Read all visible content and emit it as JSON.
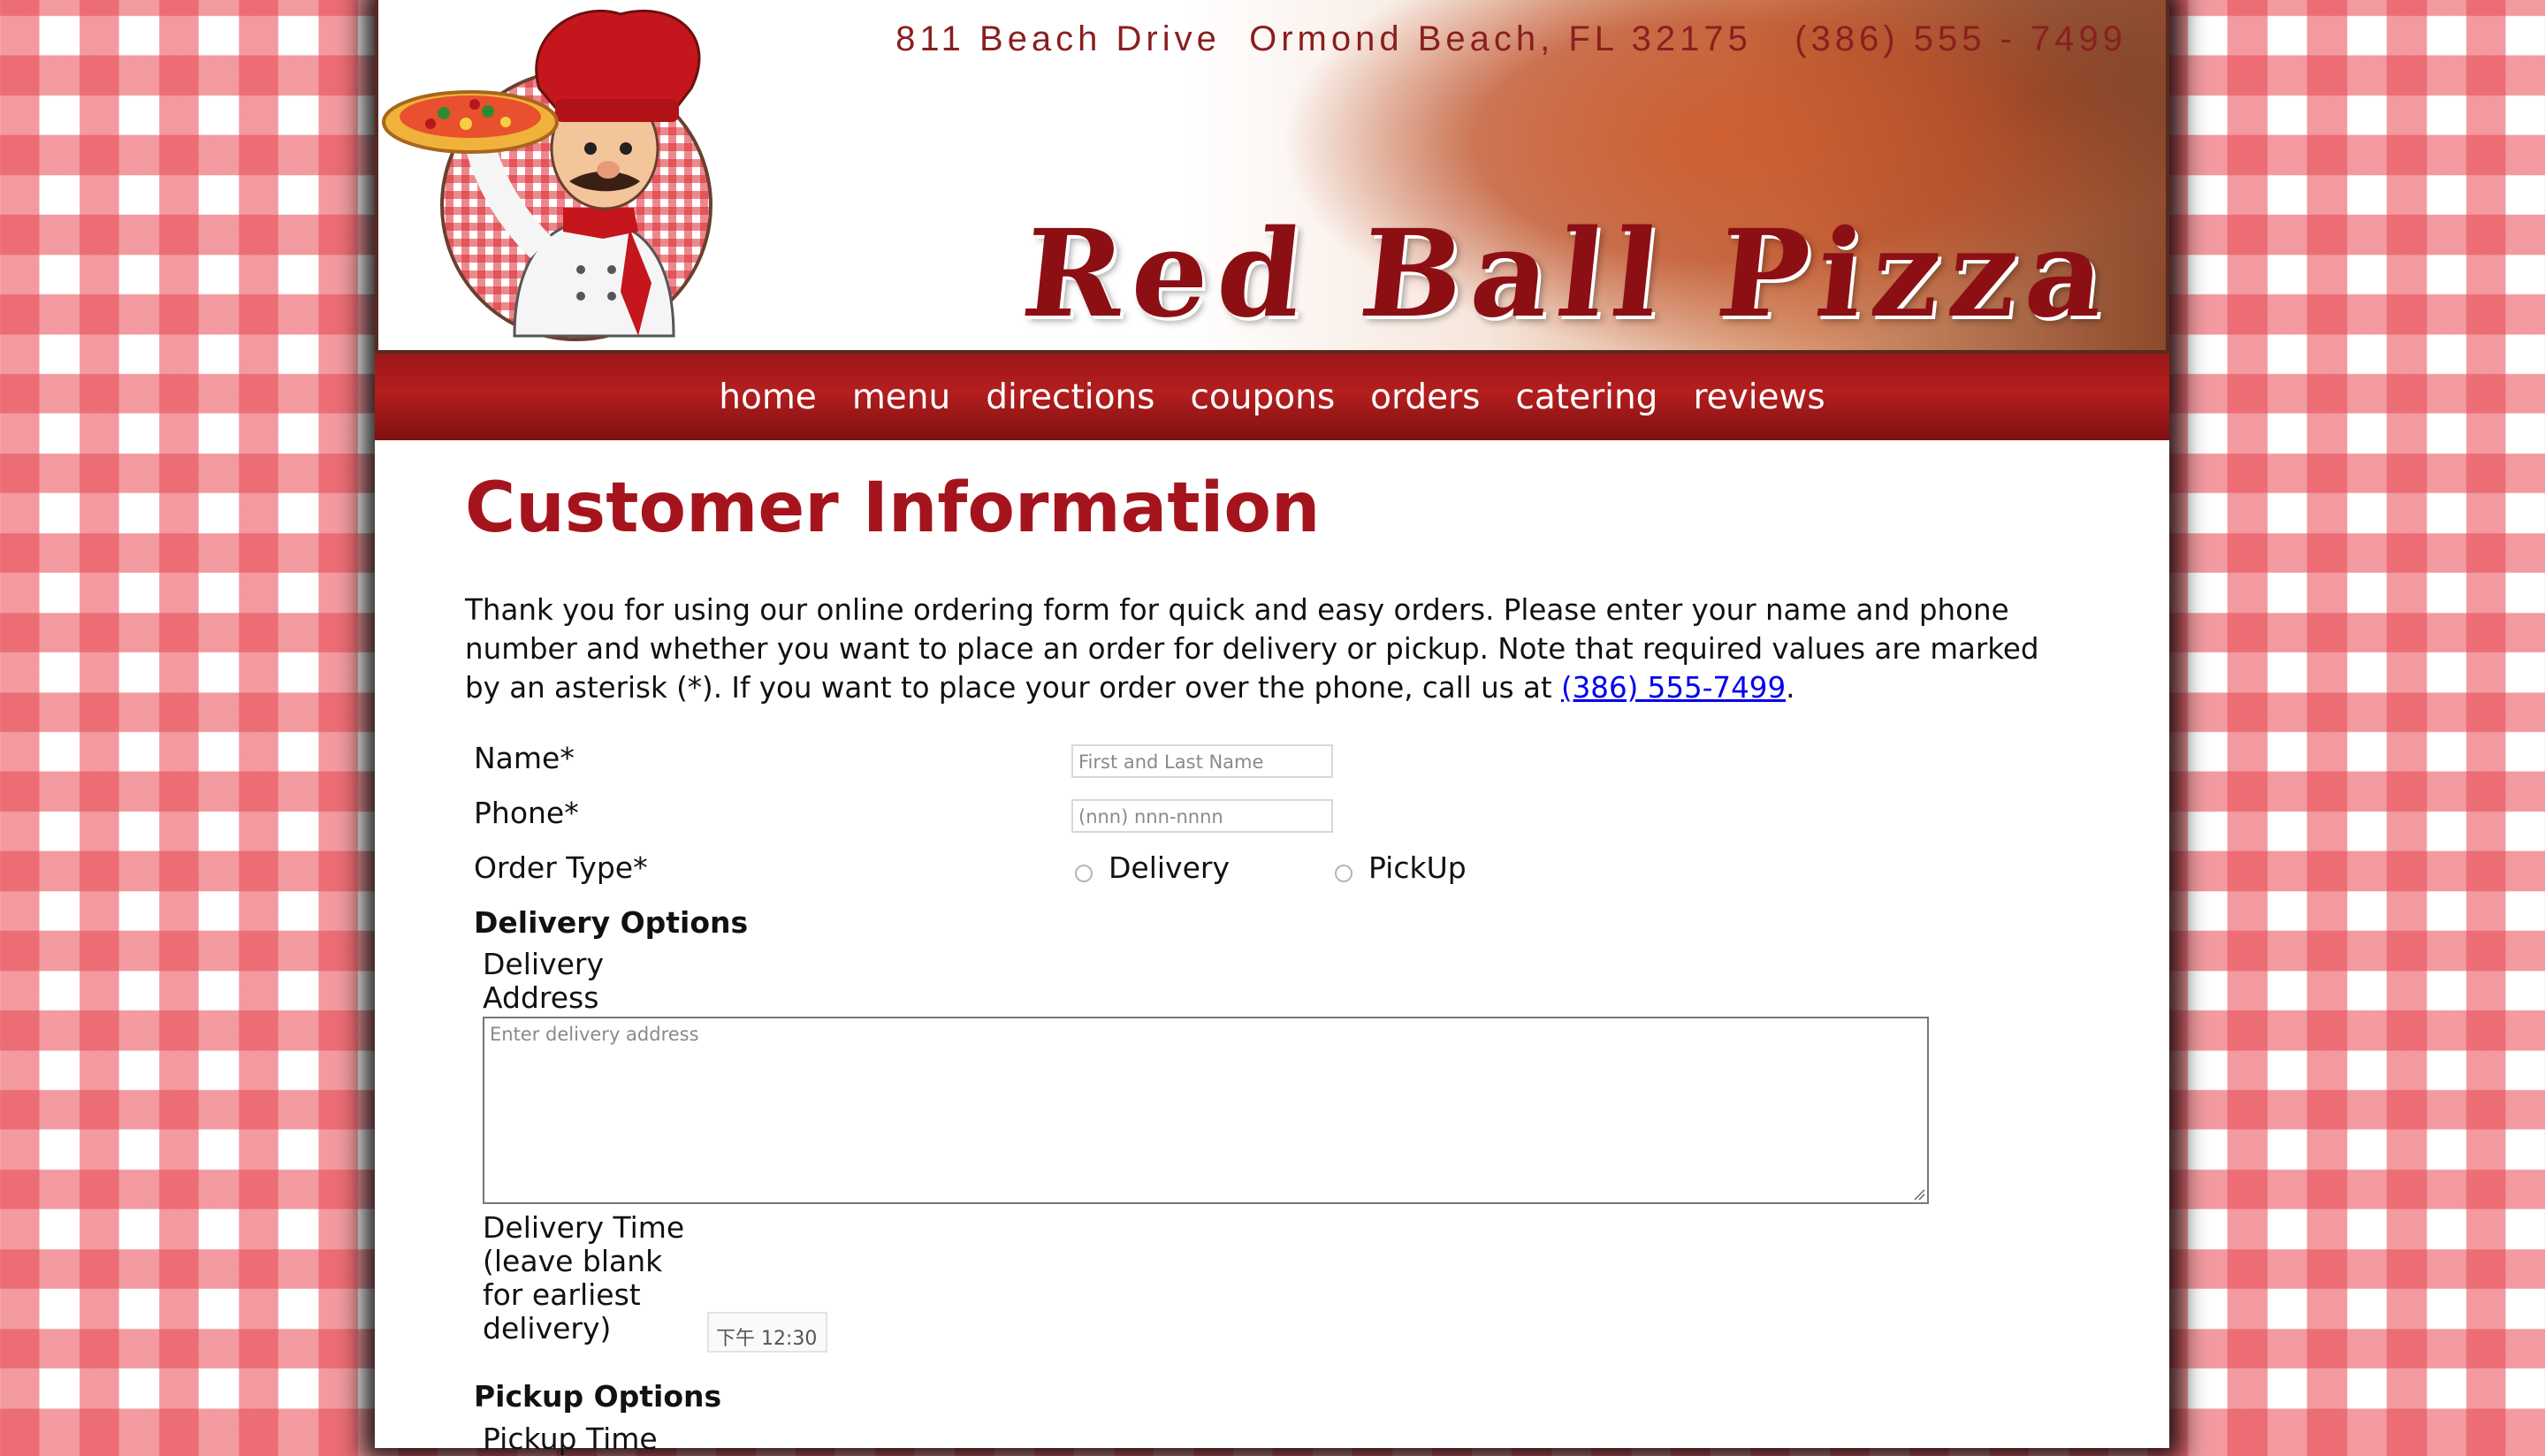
{
  "header": {
    "address": "811 Beach Drive  Ormond Beach, FL 32175   (386) 555 - 7499",
    "brand": "Red Ball Pizza"
  },
  "nav": [
    "home",
    "menu",
    "directions",
    "coupons",
    "orders",
    "catering",
    "reviews"
  ],
  "main": {
    "title": "Customer Information",
    "intro_text": "Thank you for using our online ordering form for quick and easy orders. Please enter your name and phone number and whether you want to place an order for delivery or pickup. Note that required values are marked by an asterisk (*). If you want to place your order over the phone, call us at ",
    "intro_phone_link": "(386) 555-7499",
    "intro_end": ".",
    "form": {
      "name_label": "Name*",
      "name_placeholder": "First and Last Name",
      "phone_label": "Phone*",
      "phone_placeholder": "(nnn) nnn-nnnn",
      "order_type_label": "Order Type*",
      "delivery_option": "Delivery",
      "pickup_option": "PickUp",
      "delivery_options_heading": "Delivery Options",
      "delivery_address_label_line1": "Delivery",
      "delivery_address_label_line2": "Address",
      "delivery_address_placeholder": "Enter delivery address",
      "delivery_time_label_lines": [
        "Delivery Time",
        "(leave blank",
        "for earliest",
        "delivery)"
      ],
      "delivery_time_value": "下午 12:30",
      "pickup_options_heading": "Pickup Options",
      "pickup_time_label": "Pickup Time"
    }
  }
}
